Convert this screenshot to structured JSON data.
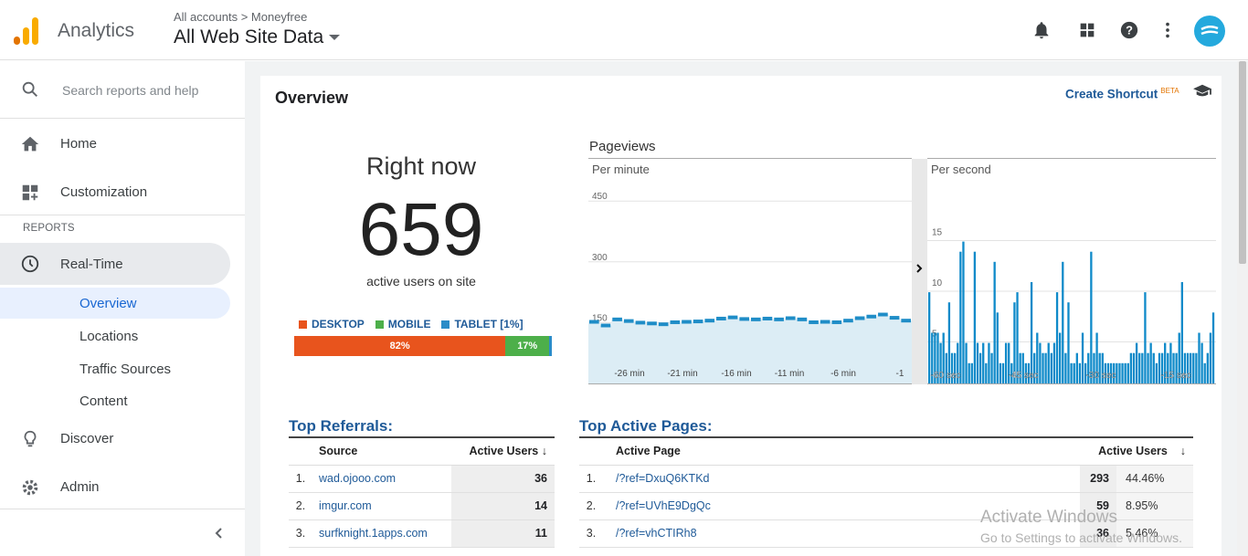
{
  "header": {
    "app_name": "Analytics",
    "breadcrumb": "All accounts > Moneyfree",
    "property": "All Web Site Data"
  },
  "sidebar": {
    "search_placeholder": "Search reports and help",
    "home": "Home",
    "customization": "Customization",
    "section_reports": "REPORTS",
    "realtime": "Real-Time",
    "sub": [
      "Overview",
      "Locations",
      "Traffic Sources",
      "Content"
    ],
    "discover": "Discover",
    "admin": "Admin"
  },
  "overview": {
    "title": "Overview",
    "create_shortcut": "Create Shortcut",
    "beta": "BETA"
  },
  "right_now": {
    "title": "Right now",
    "count": "659",
    "subtitle": "active users on site",
    "legend": [
      "DESKTOP",
      "MOBILE",
      "TABLET [1%]"
    ],
    "desktop_pct": "82%",
    "mobile_pct": "17%",
    "colors": {
      "desktop": "#e8541d",
      "mobile": "#4daf4a",
      "tablet": "#2a8cc8"
    }
  },
  "pageviews": {
    "title": "Pageviews",
    "per_minute": "Per minute",
    "per_second": "Per second",
    "min_ticks_y": [
      "450",
      "300",
      "150"
    ],
    "min_ticks_x": [
      "-26 min",
      "-21 min",
      "-16 min",
      "-11 min",
      "-6 min",
      "-1"
    ],
    "sec_ticks_y": [
      "15",
      "10",
      "5"
    ],
    "sec_ticks_x": [
      "-60 sec",
      "-45 sec",
      "-30 sec",
      "-15 sec"
    ],
    "per_minute_values": [
      152,
      143,
      158,
      154,
      150,
      148,
      146,
      151,
      152,
      153,
      155,
      160,
      163,
      159,
      158,
      160,
      158,
      161,
      158,
      151,
      152,
      151,
      155,
      161,
      165,
      170,
      162,
      155
    ],
    "per_second_values": [
      9,
      5,
      5,
      5,
      4,
      5,
      3,
      8,
      3,
      3,
      4,
      13,
      14,
      4,
      2,
      2,
      13,
      4,
      3,
      4,
      2,
      4,
      3,
      12,
      7,
      2,
      2,
      4,
      4,
      2,
      8,
      9,
      3,
      3,
      2,
      2,
      10,
      3,
      5,
      4,
      3,
      3,
      4,
      3,
      4,
      9,
      5,
      12,
      3,
      8,
      2,
      2,
      3,
      2,
      5,
      2,
      3,
      13,
      3,
      5,
      3,
      3,
      2,
      2,
      2,
      2,
      2,
      2,
      2,
      2,
      2,
      3,
      3,
      4,
      3,
      3,
      9,
      3,
      4,
      3,
      2,
      3,
      3,
      4,
      3,
      4,
      3,
      3,
      5,
      10,
      3,
      3,
      3,
      3,
      3,
      5,
      4,
      2,
      3,
      5,
      7
    ]
  },
  "top_referrals": {
    "title": "Top Referrals:",
    "col_source": "Source",
    "col_users": "Active Users",
    "rows": [
      {
        "n": "1.",
        "source": "wad.ojooo.com",
        "users": "36"
      },
      {
        "n": "2.",
        "source": "imgur.com",
        "users": "14"
      },
      {
        "n": "3.",
        "source": "surfknight.1apps.com",
        "users": "11"
      }
    ]
  },
  "top_pages": {
    "title": "Top Active Pages:",
    "col_page": "Active Page",
    "col_users": "Active Users",
    "rows": [
      {
        "n": "1.",
        "page": "/?ref=DxuQ6KTKd",
        "users": "293",
        "pct": "44.46%"
      },
      {
        "n": "2.",
        "page": "/?ref=UVhE9DgQc",
        "users": "59",
        "pct": "8.95%"
      },
      {
        "n": "3.",
        "page": "/?ref=vhCTIRh8",
        "users": "36",
        "pct": "5.46%"
      }
    ]
  },
  "watermark": {
    "line1": "Activate Windows",
    "line2": "Go to Settings to activate Windows."
  }
}
